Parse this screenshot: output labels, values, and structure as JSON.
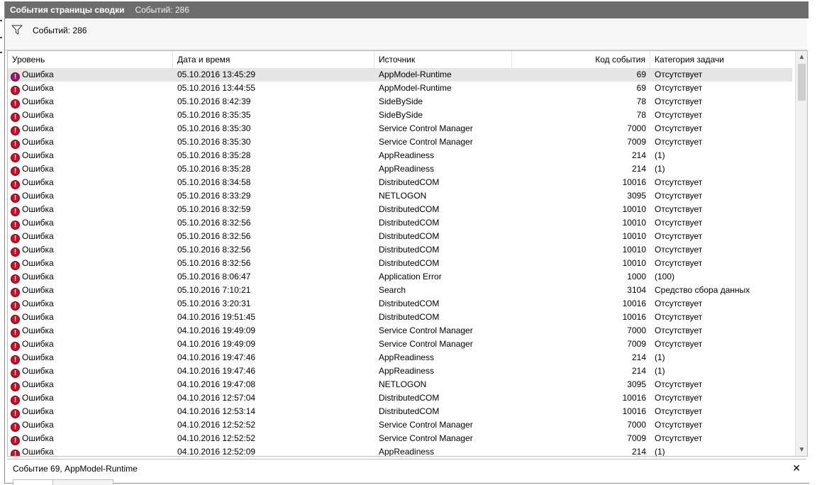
{
  "window": {
    "title": "События страницы сводки",
    "count_label": "Событий: 286"
  },
  "filter": {
    "icon": "filter-icon",
    "text": "Событий: 286"
  },
  "columns": {
    "level": "Уровень",
    "datetime": "Дата и время",
    "source": "Источник",
    "event_id": "Код события",
    "category": "Категория задачи"
  },
  "rows": [
    {
      "level": "Ошибка",
      "datetime": "05.10.2016 13:45:29",
      "source": "AppModel-Runtime",
      "event_id": "69",
      "category": "Отсутствует",
      "selected": true
    },
    {
      "level": "Ошибка",
      "datetime": "05.10.2016 13:44:55",
      "source": "AppModel-Runtime",
      "event_id": "69",
      "category": "Отсутствует"
    },
    {
      "level": "Ошибка",
      "datetime": "05.10.2016 8:42:39",
      "source": "SideBySide",
      "event_id": "78",
      "category": "Отсутствует"
    },
    {
      "level": "Ошибка",
      "datetime": "05.10.2016 8:35:35",
      "source": "SideBySide",
      "event_id": "78",
      "category": "Отсутствует"
    },
    {
      "level": "Ошибка",
      "datetime": "05.10.2016 8:35:30",
      "source": "Service Control Manager",
      "event_id": "7000",
      "category": "Отсутствует"
    },
    {
      "level": "Ошибка",
      "datetime": "05.10.2016 8:35:30",
      "source": "Service Control Manager",
      "event_id": "7009",
      "category": "Отсутствует"
    },
    {
      "level": "Ошибка",
      "datetime": "05.10.2016 8:35:28",
      "source": "AppReadiness",
      "event_id": "214",
      "category": "(1)"
    },
    {
      "level": "Ошибка",
      "datetime": "05.10.2016 8:35:28",
      "source": "AppReadiness",
      "event_id": "214",
      "category": "(1)"
    },
    {
      "level": "Ошибка",
      "datetime": "05.10.2016 8:34:58",
      "source": "DistributedCOM",
      "event_id": "10016",
      "category": "Отсутствует"
    },
    {
      "level": "Ошибка",
      "datetime": "05.10.2016 8:33:29",
      "source": "NETLOGON",
      "event_id": "3095",
      "category": "Отсутствует"
    },
    {
      "level": "Ошибка",
      "datetime": "05.10.2016 8:32:59",
      "source": "DistributedCOM",
      "event_id": "10010",
      "category": "Отсутствует"
    },
    {
      "level": "Ошибка",
      "datetime": "05.10.2016 8:32:56",
      "source": "DistributedCOM",
      "event_id": "10010",
      "category": "Отсутствует"
    },
    {
      "level": "Ошибка",
      "datetime": "05.10.2016 8:32:56",
      "source": "DistributedCOM",
      "event_id": "10010",
      "category": "Отсутствует"
    },
    {
      "level": "Ошибка",
      "datetime": "05.10.2016 8:32:56",
      "source": "DistributedCOM",
      "event_id": "10010",
      "category": "Отсутствует"
    },
    {
      "level": "Ошибка",
      "datetime": "05.10.2016 8:32:56",
      "source": "DistributedCOM",
      "event_id": "10010",
      "category": "Отсутствует"
    },
    {
      "level": "Ошибка",
      "datetime": "05.10.2016 8:06:47",
      "source": "Application Error",
      "event_id": "1000",
      "category": "(100)"
    },
    {
      "level": "Ошибка",
      "datetime": "05.10.2016 7:10:21",
      "source": "Search",
      "event_id": "3104",
      "category": "Средство сбора данных"
    },
    {
      "level": "Ошибка",
      "datetime": "05.10.2016 3:20:31",
      "source": "DistributedCOM",
      "event_id": "10016",
      "category": "Отсутствует"
    },
    {
      "level": "Ошибка",
      "datetime": "04.10.2016 19:51:45",
      "source": "DistributedCOM",
      "event_id": "10016",
      "category": "Отсутствует"
    },
    {
      "level": "Ошибка",
      "datetime": "04.10.2016 19:49:09",
      "source": "Service Control Manager",
      "event_id": "7000",
      "category": "Отсутствует"
    },
    {
      "level": "Ошибка",
      "datetime": "04.10.2016 19:49:09",
      "source": "Service Control Manager",
      "event_id": "7009",
      "category": "Отсутствует"
    },
    {
      "level": "Ошибка",
      "datetime": "04.10.2016 19:47:46",
      "source": "AppReadiness",
      "event_id": "214",
      "category": "(1)"
    },
    {
      "level": "Ошибка",
      "datetime": "04.10.2016 19:47:46",
      "source": "AppReadiness",
      "event_id": "214",
      "category": "(1)"
    },
    {
      "level": "Ошибка",
      "datetime": "04.10.2016 19:47:08",
      "source": "NETLOGON",
      "event_id": "3095",
      "category": "Отсутствует"
    },
    {
      "level": "Ошибка",
      "datetime": "04.10.2016 12:57:04",
      "source": "DistributedCOM",
      "event_id": "10016",
      "category": "Отсутствует"
    },
    {
      "level": "Ошибка",
      "datetime": "04.10.2016 12:53:14",
      "source": "DistributedCOM",
      "event_id": "10016",
      "category": "Отсутствует"
    },
    {
      "level": "Ошибка",
      "datetime": "04.10.2016 12:52:52",
      "source": "Service Control Manager",
      "event_id": "7000",
      "category": "Отсутствует"
    },
    {
      "level": "Ошибка",
      "datetime": "04.10.2016 12:52:52",
      "source": "Service Control Manager",
      "event_id": "7009",
      "category": "Отсутствует"
    },
    {
      "level": "Ошибка",
      "datetime": "04.10.2016 12:52:09",
      "source": "AppReadiness",
      "event_id": "214",
      "category": "(1)"
    }
  ],
  "details": {
    "title": "Событие 69, AppModel-Runtime",
    "close_icon": "close-icon"
  },
  "colors": {
    "titlebar": "#6d6d6d",
    "error_icon": "#c8102e",
    "selected_row": "#e5e5e5"
  }
}
